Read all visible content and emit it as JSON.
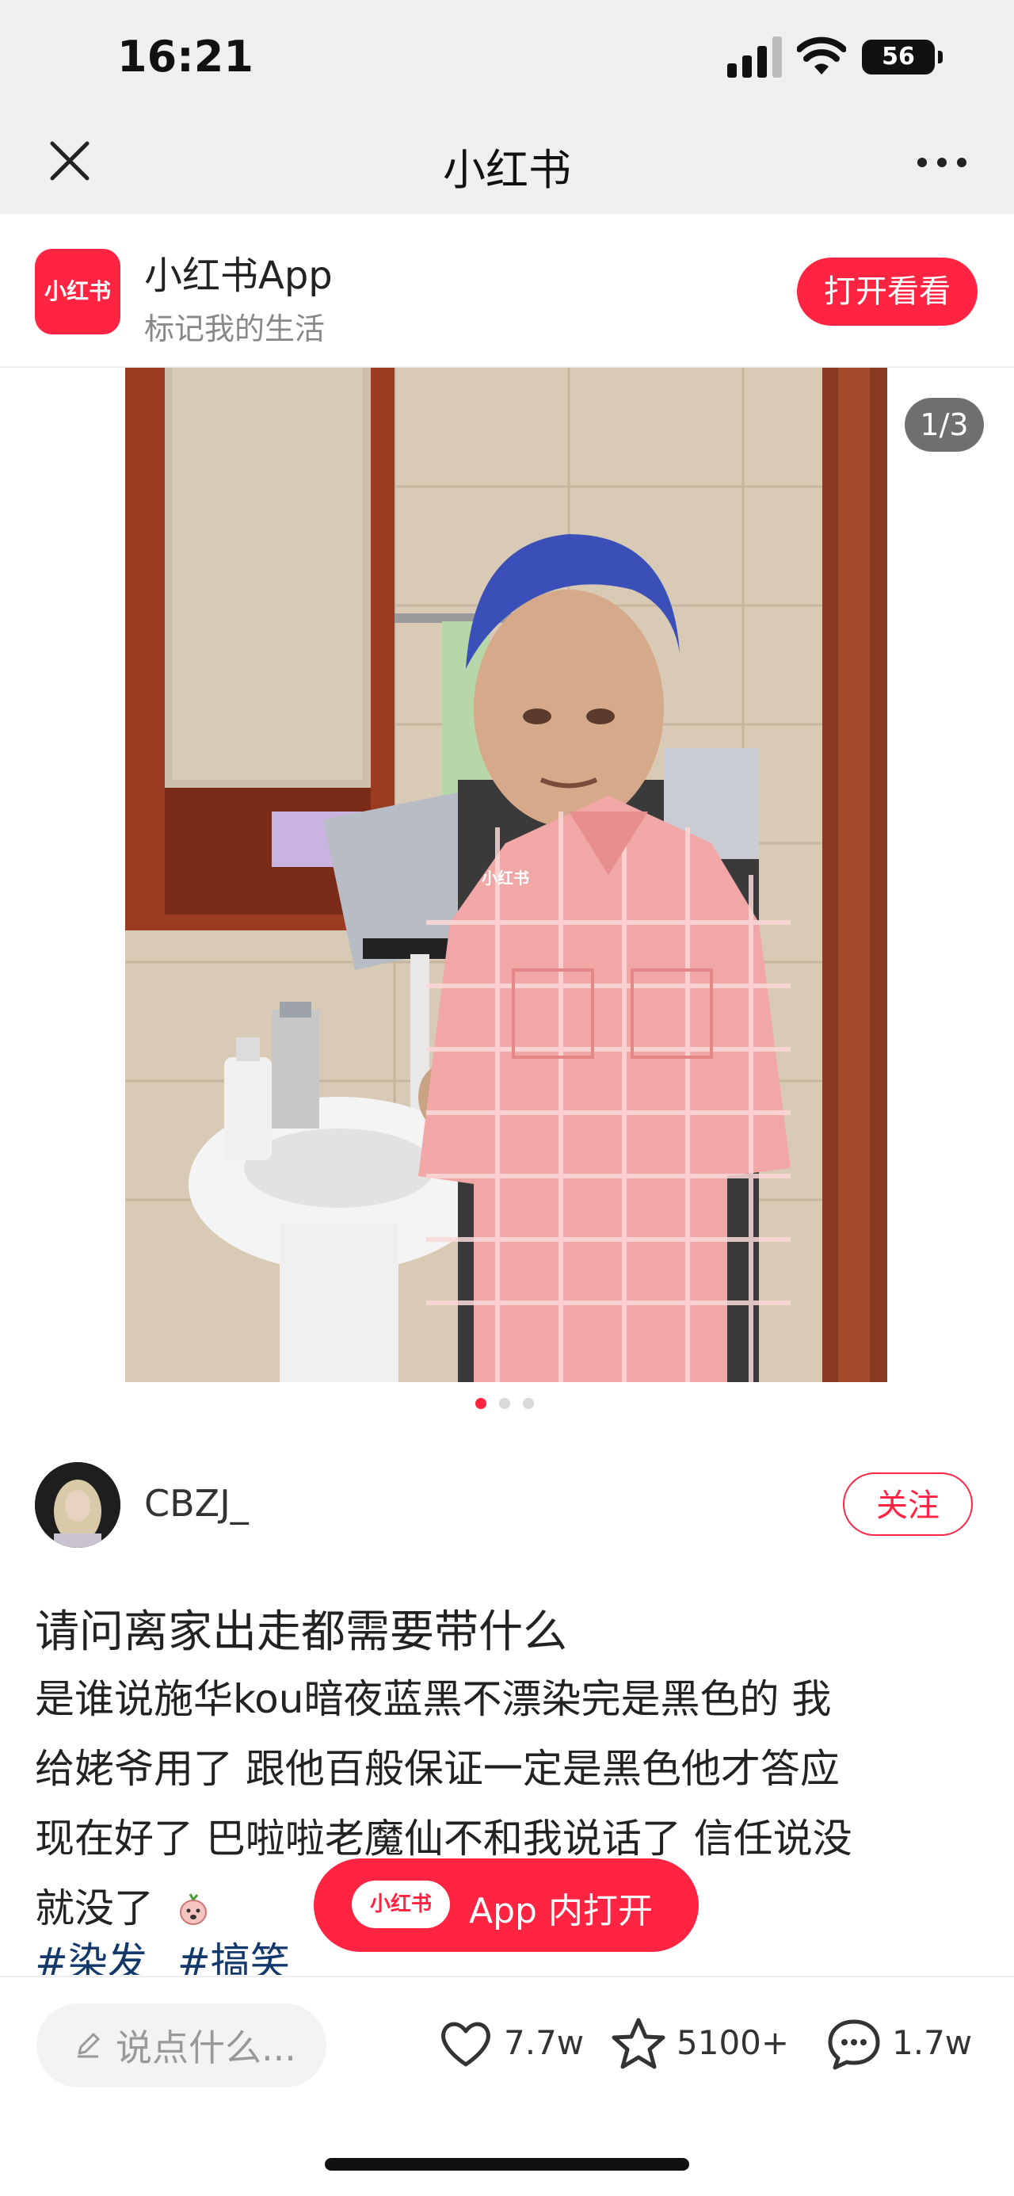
{
  "status_bar": {
    "time": "16:21",
    "battery": "56"
  },
  "nav": {
    "title": "小红书"
  },
  "banner": {
    "app_icon_text": "小红书",
    "app_name": "小红书App",
    "slogan": "标记我的生活",
    "open_button": "打开看看"
  },
  "photo": {
    "page_indicator": "1/3",
    "watermark": "小红书",
    "total_images": 3,
    "current_image": 1
  },
  "author": {
    "name": "CBZJ_",
    "follow_button": "关注"
  },
  "post": {
    "title": "请问离家出走都需要带什么",
    "body_lines": [
      "是谁说施华kou暗夜蓝黑不漂染完是黑色的 我",
      "给姥爷用了 跟他百般保证一定是黑色他才答应",
      "现在好了 巴啦啦老魔仙不和我说话了 信任说没",
      "就没了"
    ],
    "tags": [
      "#染发",
      "#搞笑"
    ]
  },
  "float_button": {
    "logo": "小红书",
    "label": "App 内打开"
  },
  "bottom_bar": {
    "comment_placeholder": "说点什么...",
    "likes": "7.7w",
    "collects": "5100+",
    "comments": "1.7w"
  },
  "colors": {
    "brand_red": "#ff2442",
    "tag_blue": "#13386c",
    "hair_blue": "#3a4fb8",
    "shirt_pink": "#f2a7a7"
  },
  "icons": [
    "signal-icon",
    "wifi-icon",
    "battery-icon",
    "close-icon",
    "more-icon",
    "heart-icon",
    "star-icon",
    "comment-bubble-icon",
    "pencil-icon",
    "emoji-icon"
  ]
}
